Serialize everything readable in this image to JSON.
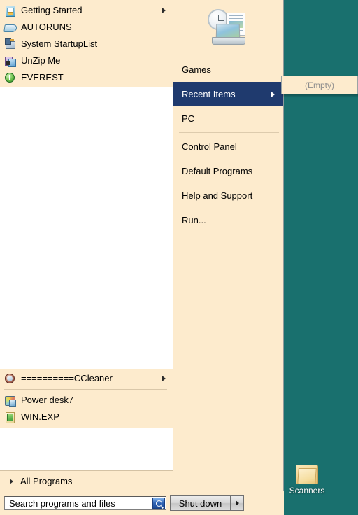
{
  "desktop": {
    "background_color": "#19706e",
    "icons": [
      {
        "label": "Scanners",
        "icon": "folder-icon"
      }
    ]
  },
  "start_menu": {
    "background_color": "#fdebcd",
    "highlight_color": "#1f3a6e",
    "left_pane": {
      "pinned_items": [
        {
          "label": "Getting Started",
          "icon": "getting-started-icon",
          "has_submenu": true
        },
        {
          "label": "AUTORUNS",
          "icon": "autoruns-icon",
          "has_submenu": false
        },
        {
          "label": "System StartupList",
          "icon": "system-startuplist-icon",
          "has_submenu": false
        },
        {
          "label": "UnZip Me",
          "icon": "unzip-me-icon",
          "has_submenu": false
        },
        {
          "label": "EVEREST",
          "icon": "everest-icon",
          "has_submenu": false
        }
      ],
      "recent_items": [
        {
          "label": "==========CCleaner",
          "icon": "ccleaner-icon",
          "has_submenu": true
        },
        {
          "label": "Power desk7",
          "icon": "powerdesk-icon",
          "has_submenu": false
        },
        {
          "label": "WIN.EXP",
          "icon": "winexp-icon",
          "has_submenu": false
        }
      ],
      "all_programs_label": "All Programs"
    },
    "right_pane": {
      "user_picture_icon": "clock-computer-icon",
      "items": [
        {
          "label": "Games",
          "has_submenu": false,
          "selected": false,
          "separator_after": false
        },
        {
          "label": "Recent Items",
          "has_submenu": true,
          "selected": true,
          "separator_after": false
        },
        {
          "label": "PC",
          "has_submenu": false,
          "selected": false,
          "separator_after": true
        },
        {
          "label": "Control Panel",
          "has_submenu": false,
          "selected": false,
          "separator_after": false
        },
        {
          "label": "Default Programs",
          "has_submenu": false,
          "selected": false,
          "separator_after": false
        },
        {
          "label": "Help and Support",
          "has_submenu": false,
          "selected": false,
          "separator_after": false
        },
        {
          "label": "Run...",
          "has_submenu": false,
          "selected": false,
          "separator_after": false
        }
      ]
    },
    "submenu_recent_items": {
      "items": [
        {
          "label": "(Empty)",
          "disabled": true
        }
      ]
    },
    "bottom_bar": {
      "search": {
        "value": "Search programs and files",
        "placeholder": "Search programs and files",
        "icon": "search-icon"
      },
      "shutdown_label": "Shut down",
      "shutdown_arrow_icon": "chevron-right-icon"
    }
  }
}
